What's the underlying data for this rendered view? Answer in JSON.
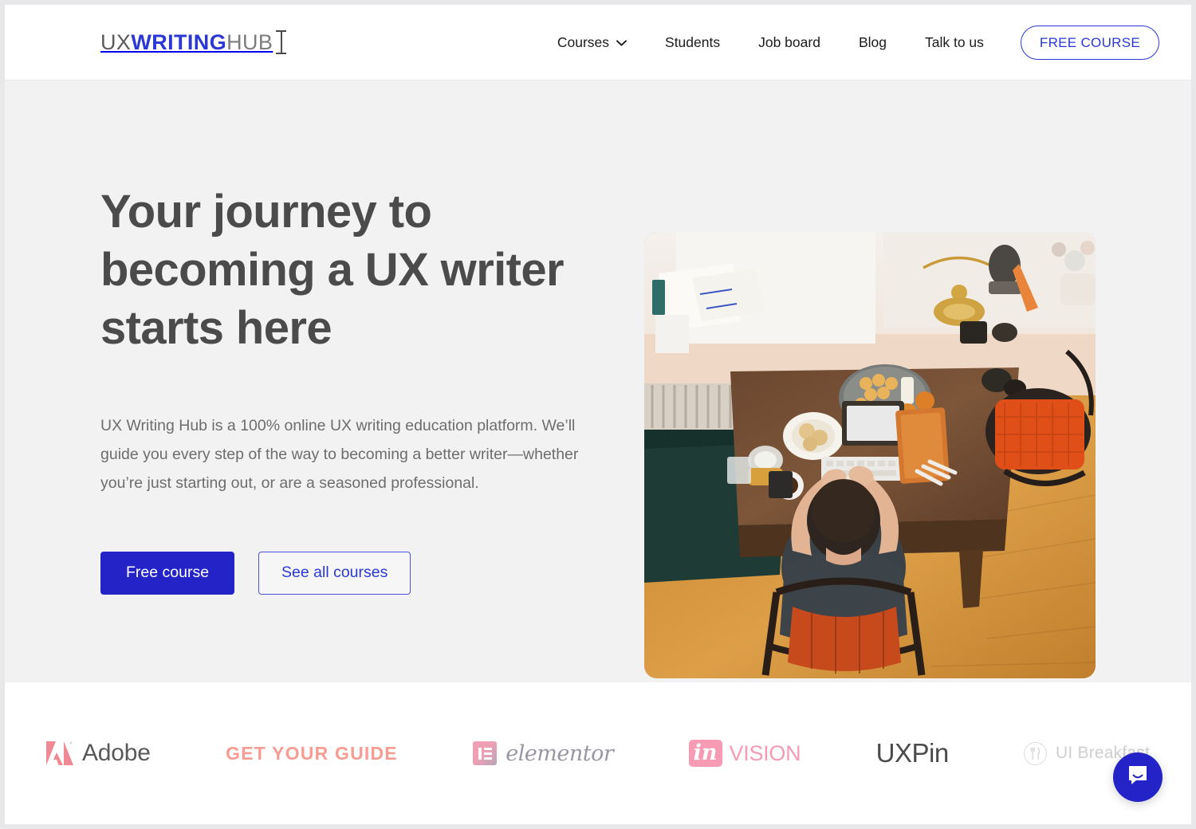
{
  "header": {
    "logo": {
      "part1": "UX",
      "part2": "WRITING",
      "part3": "HUB",
      "cursor_icon": "text-cursor-icon"
    },
    "nav": [
      {
        "label": "Courses",
        "has_dropdown": true,
        "icon": "chevron-down-icon"
      },
      {
        "label": "Students",
        "has_dropdown": false
      },
      {
        "label": "Job board",
        "has_dropdown": false
      },
      {
        "label": "Blog",
        "has_dropdown": false
      },
      {
        "label": "Talk to us",
        "has_dropdown": false
      }
    ],
    "cta_button": "FREE COURSE"
  },
  "hero": {
    "title": "Your journey to becoming a UX writer starts here",
    "paragraph": "UX Writing Hub is a 100% online UX writing education platform. We’ll guide you every step of the way to becoming a better writer—whether you’re just starting out, or are a seasoned professional.",
    "primary_button": "Free course",
    "secondary_button": "See all courses",
    "image_alt": "person-typing-at-wooden-desk-top-down-photo"
  },
  "logos": [
    {
      "name": "Adobe",
      "icon": "adobe-logo-icon"
    },
    {
      "name": "GET YOUR GUIDE",
      "icon": "getyourguide-logo-icon"
    },
    {
      "name": "elementor",
      "icon": "elementor-logo-icon"
    },
    {
      "name": "VISION",
      "prefix": "in",
      "icon": "invision-logo-icon"
    },
    {
      "name": "UXPin",
      "icon": "uxpin-logo-icon"
    },
    {
      "name": "UI Breakfast",
      "icon": "ui-breakfast-logo-icon"
    }
  ],
  "chat": {
    "icon": "chat-bubble-icon",
    "label": "Open chat"
  },
  "colors": {
    "brand_blue": "#2323c8",
    "nav_blue": "#2b38d6",
    "hero_bg": "#f2f2f2",
    "heading_gray": "#4b4b4b",
    "body_gray": "#6d6d6d",
    "pink": "#f79ab4",
    "salmon": "#f79c92"
  }
}
